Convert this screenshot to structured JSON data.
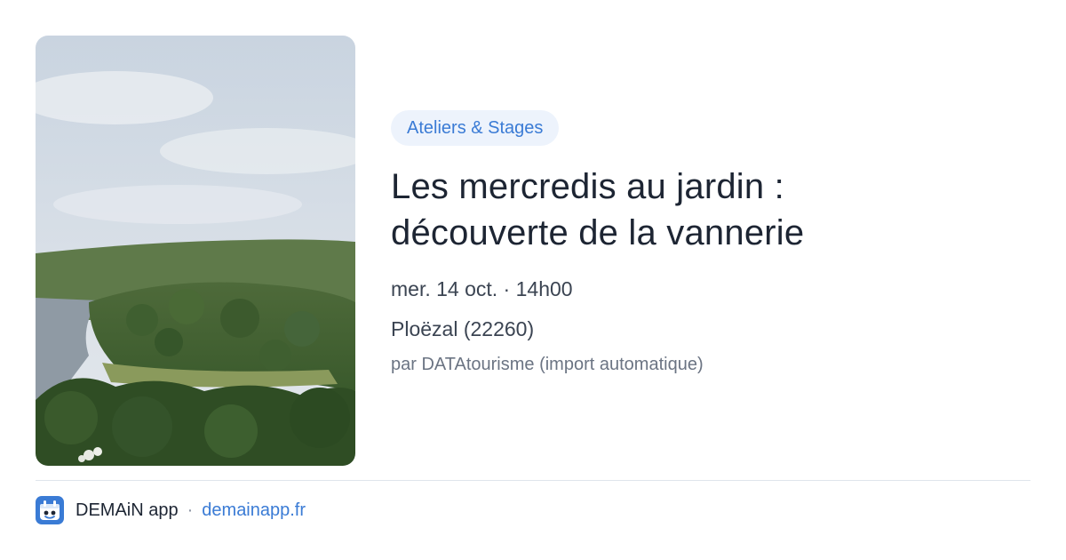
{
  "card": {
    "image_icon": "landscape-photo",
    "category": "Ateliers & Stages",
    "title_line1": "Les mercredis au jardin :",
    "title_line2": "découverte de la vannerie",
    "datetime": "mer. 14 oct. · 14h00",
    "location": "Ploëzal (22260)",
    "source": "par DATAtourisme (import automatique)"
  },
  "footer": {
    "app_icon": "demain-app-icon",
    "app_name": "DEMAiN app",
    "separator": "·",
    "url": "demainapp.fr"
  },
  "colors": {
    "accent": "#3a7bd5",
    "category_bg": "#edf3fc",
    "title": "#1d2533",
    "meta": "#3b4452",
    "muted": "#6b7483",
    "divider": "#dfe5ec"
  }
}
